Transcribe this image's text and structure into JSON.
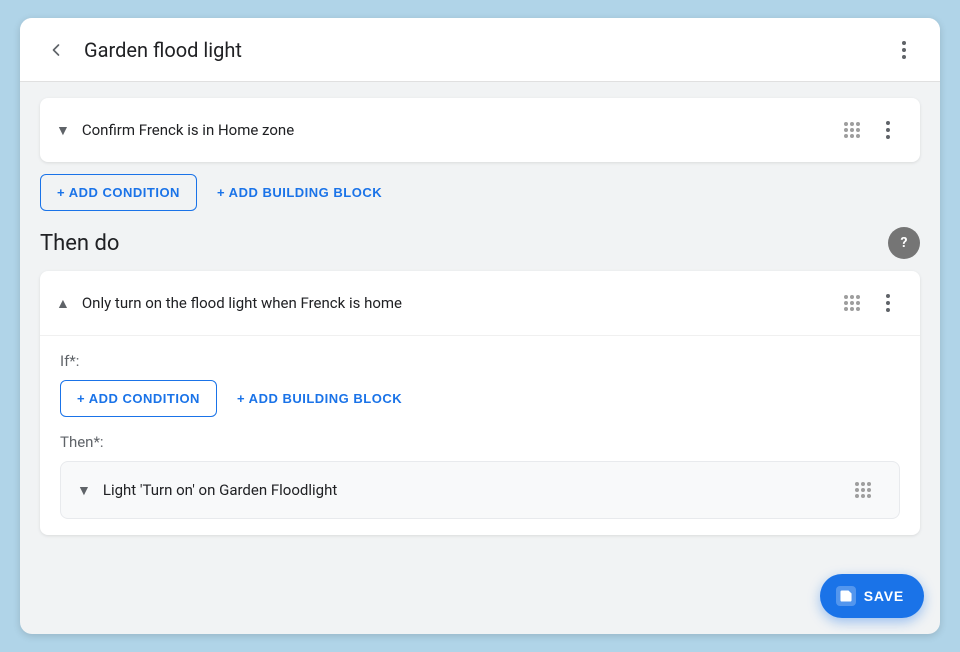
{
  "header": {
    "title": "Garden flood light",
    "back_label": "back",
    "more_label": "more options"
  },
  "conditions_section": {
    "condition_row_label": "Confirm Frenck is in Home zone",
    "add_condition_btn": "+ ADD CONDITION",
    "add_building_block_btn": "+ ADD BUILDING BLOCK"
  },
  "then_do_section": {
    "title": "Then do",
    "help_label": "?",
    "block_label": "Only turn on the flood light when Frenck is home",
    "if_label": "If*:",
    "add_condition_btn": "+ ADD CONDITION",
    "add_building_block_btn": "+ ADD BUILDING BLOCK",
    "then_label": "Then*:",
    "light_action_label": "Light 'Turn on' on Garden Floodlight"
  },
  "save_btn": {
    "label": "SAVE",
    "icon": "💾"
  }
}
